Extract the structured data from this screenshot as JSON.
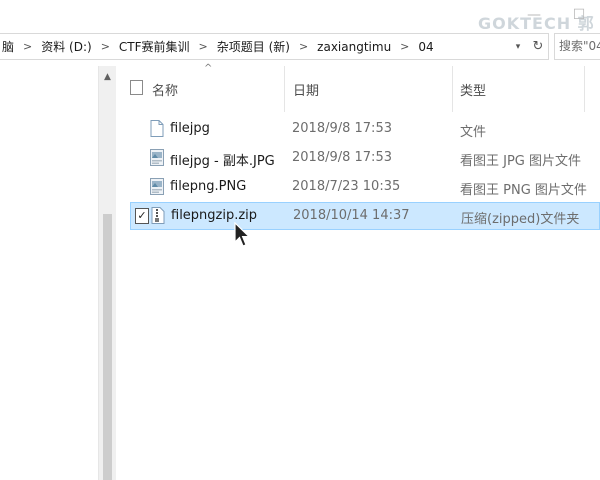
{
  "window": {
    "ghost_text": "",
    "watermark": "GOKTECH 郭"
  },
  "address": {
    "crumbs": [
      "脑",
      "资料 (D:)",
      "CTF赛前集训",
      "杂项题目 (新)",
      "zaxiangtimu",
      "04"
    ],
    "search_placeholder": "搜索\"04"
  },
  "list": {
    "columns": {
      "name": "名称",
      "date": "日期",
      "type": "类型"
    },
    "rows": [
      {
        "name": "filejpg",
        "date": "2018/9/8 17:53",
        "type": "文件",
        "icon": "blank-file-icon",
        "selected": false
      },
      {
        "name": "filejpg - 副本.JPG",
        "date": "2018/9/8 17:53",
        "type": "看图王 JPG 图片文件",
        "icon": "image-file-icon",
        "selected": false
      },
      {
        "name": "filepng.PNG",
        "date": "2018/7/23 10:35",
        "type": "看图王 PNG 图片文件",
        "icon": "image-file-icon",
        "selected": false
      },
      {
        "name": "filepngzip.zip",
        "date": "2018/10/14 14:37",
        "type": "压缩(zipped)文件夹",
        "icon": "zip-file-icon",
        "selected": true
      }
    ]
  },
  "colors": {
    "selection_bg": "#cce8ff",
    "selection_border": "#99d1ff",
    "secondary_text": "#6d6d6d"
  }
}
